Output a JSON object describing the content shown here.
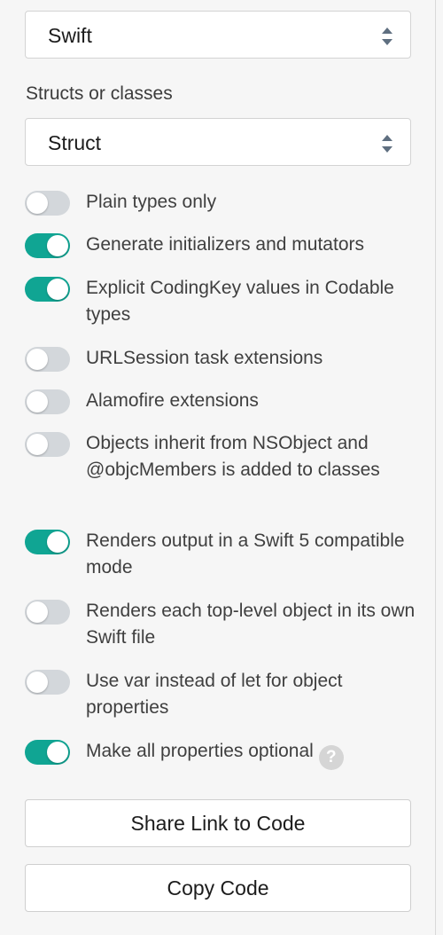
{
  "language_select": {
    "value": "Swift"
  },
  "struct_label": "Structs or classes",
  "struct_select": {
    "value": "Struct"
  },
  "options": [
    {
      "label": "Plain types only",
      "on": false
    },
    {
      "label": "Generate initializers and mutators",
      "on": true
    },
    {
      "label": "Explicit CodingKey values in Codable types",
      "on": true
    },
    {
      "label": "URLSession task extensions",
      "on": false
    },
    {
      "label": "Alamofire extensions",
      "on": false
    },
    {
      "label": "Objects inherit from NSObject and @objcMembers is added to classes",
      "on": false
    },
    {
      "label": "Renders output in a Swift 5 compatible mode",
      "on": true
    },
    {
      "label": "Renders each top-level object in its own Swift file",
      "on": false
    },
    {
      "label": "Use var instead of let for object properties",
      "on": false
    },
    {
      "label": "Make all properties optional",
      "on": true,
      "help_icon": "question-circle-icon"
    }
  ],
  "help_glyph": "?",
  "buttons": {
    "share": "Share Link to Code",
    "copy": "Copy Code"
  },
  "colors": {
    "toggle_on": "#10a593",
    "toggle_off": "#d3d7db"
  }
}
